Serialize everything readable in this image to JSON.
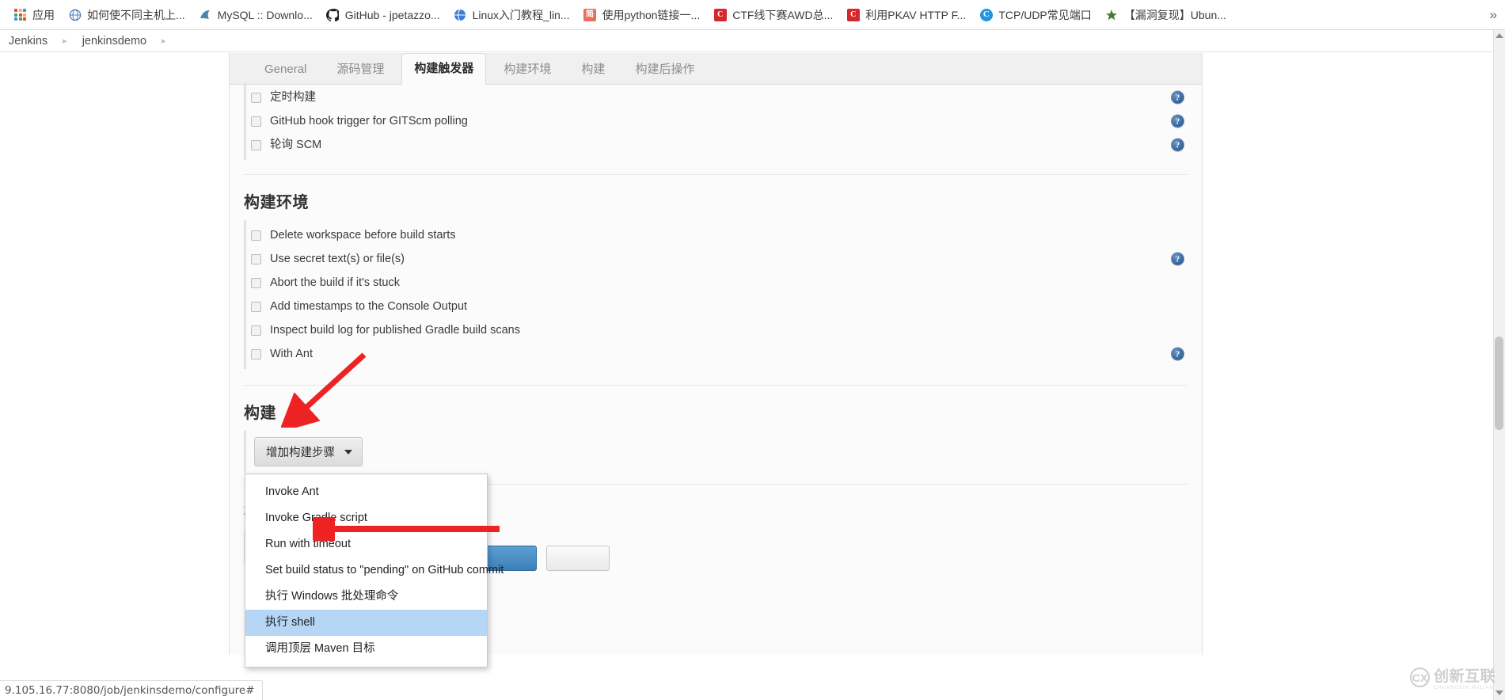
{
  "browser": {
    "bookmarks": [
      {
        "label": "应用",
        "icon": "apps-grid-icon",
        "color": "#ffffff"
      },
      {
        "label": "如何使不同主机上...",
        "icon": "globe-icon",
        "color": "#4a7fb5"
      },
      {
        "label": "MySQL :: Downlo...",
        "icon": "mysql-dolphin-icon",
        "color": "#00758f"
      },
      {
        "label": "GitHub - jpetazzo...",
        "icon": "github-icon",
        "color": "#24292e"
      },
      {
        "label": "Linux入门教程_lin...",
        "icon": "globe-icon",
        "color": "#3b7dd8"
      },
      {
        "label": "使用python链接一...",
        "icon": "jianshu-icon",
        "color": "#ea6f5a"
      },
      {
        "label": "CTF线下赛AWD总...",
        "icon": "csdn-icon",
        "color": "#d7262c"
      },
      {
        "label": "利用PKAV HTTP F...",
        "icon": "csdn-icon",
        "color": "#d7262c"
      },
      {
        "label": "TCP/UDP常见端口",
        "icon": "cnblogs-icon",
        "color": "#2196e3"
      },
      {
        "label": "【漏洞复现】Ubun...",
        "icon": "star-icon",
        "color": "#4a7c2f"
      }
    ],
    "overflow_label": "»",
    "status_url": "9.105.16.77:8080/job/jenkinsdemo/configure#"
  },
  "breadcrumb": {
    "items": [
      "Jenkins",
      "jenkinsdemo"
    ],
    "separator": "▸"
  },
  "tabs": [
    {
      "label": "General",
      "active": false
    },
    {
      "label": "源码管理",
      "active": false
    },
    {
      "label": "构建触发器",
      "active": true
    },
    {
      "label": "构建环境",
      "active": false
    },
    {
      "label": "构建",
      "active": false
    },
    {
      "label": "构建后操作",
      "active": false
    }
  ],
  "triggers": {
    "options": [
      {
        "label": "定时构建",
        "checked": false,
        "help": true
      },
      {
        "label": "GitHub hook trigger for GITScm polling",
        "checked": false,
        "help": true
      },
      {
        "label": "轮询 SCM",
        "checked": false,
        "help": true
      }
    ]
  },
  "build_environment": {
    "title": "构建环境",
    "options": [
      {
        "label": "Delete workspace before build starts",
        "checked": false,
        "help": false
      },
      {
        "label": "Use secret text(s) or file(s)",
        "checked": false,
        "help": true
      },
      {
        "label": "Abort the build if it's stuck",
        "checked": false,
        "help": false
      },
      {
        "label": "Add timestamps to the Console Output",
        "checked": false,
        "help": false
      },
      {
        "label": "Inspect build log for published Gradle build scans",
        "checked": false,
        "help": false
      },
      {
        "label": "With Ant",
        "checked": false,
        "help": true
      }
    ]
  },
  "build": {
    "title": "构建",
    "add_step_button": "增加构建步骤",
    "caret": "▼",
    "menu_items": [
      {
        "label": "Invoke Ant",
        "selected": false
      },
      {
        "label": "Invoke Gradle script",
        "selected": false
      },
      {
        "label": "Run with timeout",
        "selected": false
      },
      {
        "label": "Set build status to \"pending\" on GitHub commit",
        "selected": false
      },
      {
        "label": "执行 Windows 批处理命令",
        "selected": false
      },
      {
        "label": "执行 shell",
        "selected": true
      },
      {
        "label": "调用顶层 Maven 目标",
        "selected": false
      }
    ]
  },
  "post_build": {
    "title": "构建后操作"
  },
  "annotations": {
    "arrow_color": "#ee2222",
    "arrow_to_add_step": "增加构建步骤",
    "arrow_to_menu_item": "执行 shell"
  },
  "watermark": {
    "mark": "CX",
    "text": "创新互联",
    "subtext": "CHUANGXIN HULIAN"
  },
  "help_icon_glyph": "?"
}
